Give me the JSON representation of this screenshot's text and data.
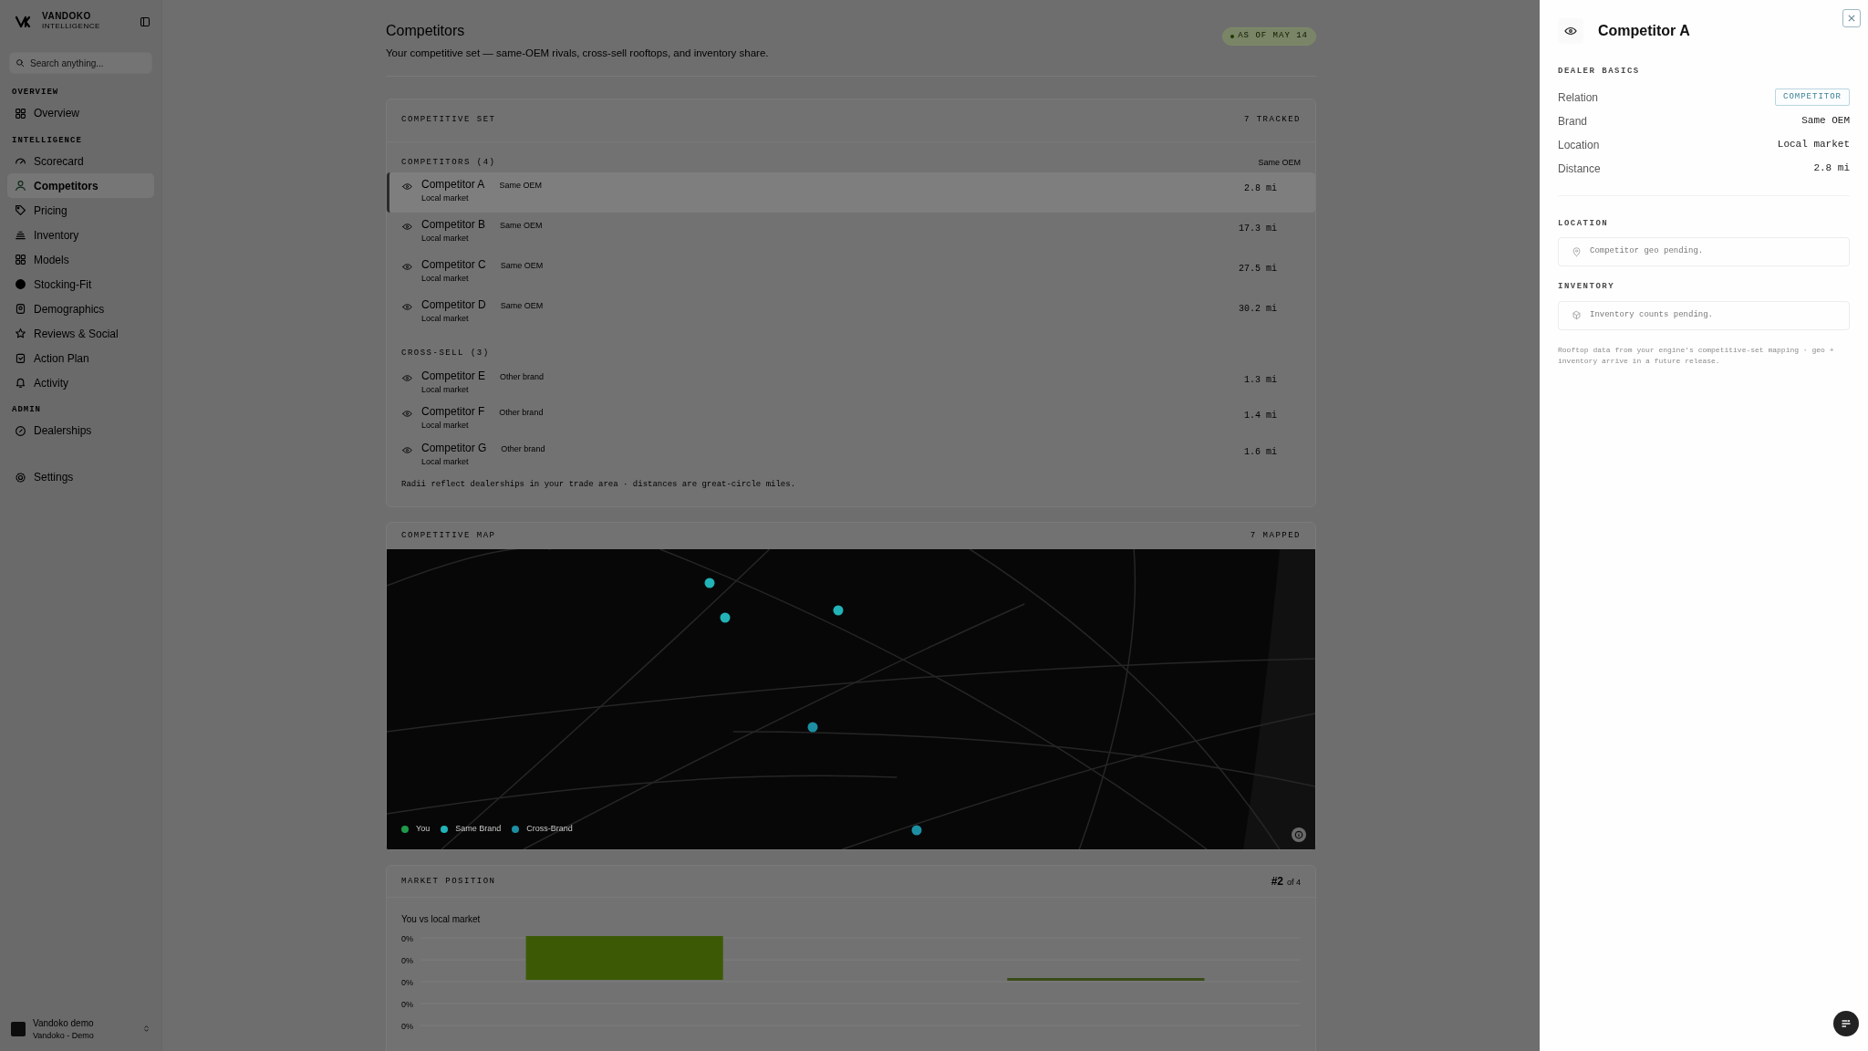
{
  "sidebar": {
    "brand": {
      "name": "VANDOKO",
      "tagline": "INTELLIGENCE"
    },
    "search": {
      "placeholder": "Search anything..."
    },
    "sections": [
      {
        "title": "OVERVIEW",
        "items": [
          {
            "label": "Overview",
            "selected": false
          }
        ]
      },
      {
        "title": "INTELLIGENCE",
        "items": [
          {
            "label": "Scorecard",
            "selected": false
          },
          {
            "label": "Competitors",
            "selected": true
          },
          {
            "label": "Pricing",
            "selected": false
          },
          {
            "label": "Inventory",
            "selected": false
          },
          {
            "label": "Models",
            "selected": false
          },
          {
            "label": "Stocking-Fit",
            "selected": false
          },
          {
            "label": "Demographics",
            "selected": false
          },
          {
            "label": "Reviews & Social",
            "selected": false
          },
          {
            "label": "Action Plan",
            "selected": false
          },
          {
            "label": "Activity",
            "selected": false
          }
        ]
      },
      {
        "title": "ADMIN",
        "items": [
          {
            "label": "Dealerships",
            "selected": false
          }
        ]
      }
    ],
    "settings": {
      "label": "Settings"
    },
    "account": {
      "name": "Vandoko demo",
      "org": "Vandoko - Demo"
    }
  },
  "page": {
    "title": "Competitors",
    "subtitle": "Your competitive set — same-OEM rivals, cross-sell rooftops, and inventory share.",
    "badge": "AS OF MAY 14"
  },
  "competitive_set": {
    "title": "COMPETITIVE SET",
    "count": "7 TRACKED",
    "groups": [
      {
        "title": "COMPETITORS (4)",
        "note": "Same OEM",
        "rows": [
          {
            "name": "Competitor A",
            "tag": "Same OEM",
            "location": "Local market",
            "distance": "2.8 mi",
            "selected": true
          },
          {
            "name": "Competitor B",
            "tag": "Same OEM",
            "location": "Local market",
            "distance": "17.3 mi",
            "selected": false
          },
          {
            "name": "Competitor C",
            "tag": "Same OEM",
            "location": "Local market",
            "distance": "27.5 mi",
            "selected": false
          },
          {
            "name": "Competitor D",
            "tag": "Same OEM",
            "location": "Local market",
            "distance": "30.2 mi",
            "selected": false
          }
        ]
      },
      {
        "title": "CROSS-SELL (3)",
        "rows": [
          {
            "name": "Competitor E",
            "tag": "Other brand",
            "location": "Local market",
            "distance": "1.3 mi",
            "selected": false
          },
          {
            "name": "Competitor F",
            "tag": "Other brand",
            "location": "Local market",
            "distance": "1.4 mi",
            "selected": false
          },
          {
            "name": "Competitor G",
            "tag": "Other brand",
            "location": "Local market",
            "distance": "1.6 mi",
            "selected": false
          }
        ]
      }
    ],
    "footnote": "Radii reflect dealerships in your trade area · distances are great-circle miles."
  },
  "map": {
    "title": "COMPETITIVE MAP",
    "count": "7 MAPPED",
    "legend": [
      {
        "label": "You",
        "color": "#1f9a4a"
      },
      {
        "label": "Same Brand",
        "color": "#22b3b8"
      },
      {
        "label": "Cross-Brand",
        "color": "#1d8fa3"
      }
    ],
    "markers": [
      {
        "color": "#22b3b8"
      },
      {
        "color": "#22b3b8"
      },
      {
        "color": "#22b3b8"
      },
      {
        "color": "#1d8fa3"
      },
      {
        "color": "#1d8fa3"
      }
    ]
  },
  "market_position": {
    "title": "MARKET POSITION",
    "rank": "#2",
    "rank_of": "of 4",
    "subtitle": "You vs local market",
    "y_labels": [
      "0%",
      "0%",
      "0%",
      "0%",
      "0%"
    ]
  },
  "drawer": {
    "title": "Competitor A",
    "section": "DEALER BASICS",
    "fields": [
      {
        "label": "Relation",
        "value": "COMPETITOR",
        "kind": "badge"
      },
      {
        "label": "Brand",
        "value": "Same OEM",
        "kind": "text"
      },
      {
        "label": "Location",
        "value": "Local market",
        "kind": "text"
      },
      {
        "label": "Distance",
        "value": "2.8 mi",
        "kind": "text"
      }
    ],
    "panels": [
      {
        "title": "LOCATION",
        "message": "Competitor geo pending.",
        "kind": "pin"
      },
      {
        "title": "INVENTORY",
        "message": "Inventory counts pending.",
        "kind": "box"
      }
    ],
    "note": "Rooftop data from your engine's competitive-set mapping · geo + inventory arrive in a future release."
  }
}
